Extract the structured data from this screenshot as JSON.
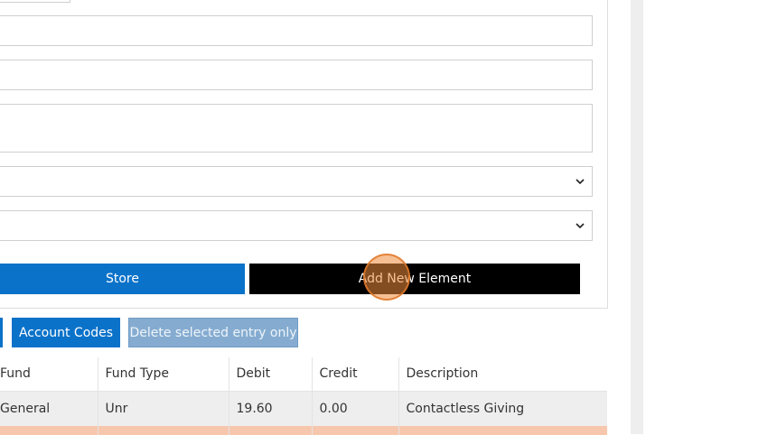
{
  "form": {
    "select_1_value": "",
    "select_2_value": ""
  },
  "buttons": {
    "store_label": "Store",
    "add_label": "Add New Element",
    "accounts_label": "Account Codes",
    "delete_label": "Delete selected entry only"
  },
  "table": {
    "headers": [
      "Fund",
      "Fund Type",
      "Debit",
      "Credit",
      "Description"
    ],
    "rows": [
      [
        "General",
        "Unr",
        "19.60",
        "0.00",
        "Contactless Giving"
      ]
    ]
  },
  "colors": {
    "primary": "#0a72c9",
    "add_button": "#000000",
    "disabled_button": "#85acd0",
    "selected_row": "#f6c7ad",
    "click_indicator": "#ee8c3c"
  }
}
